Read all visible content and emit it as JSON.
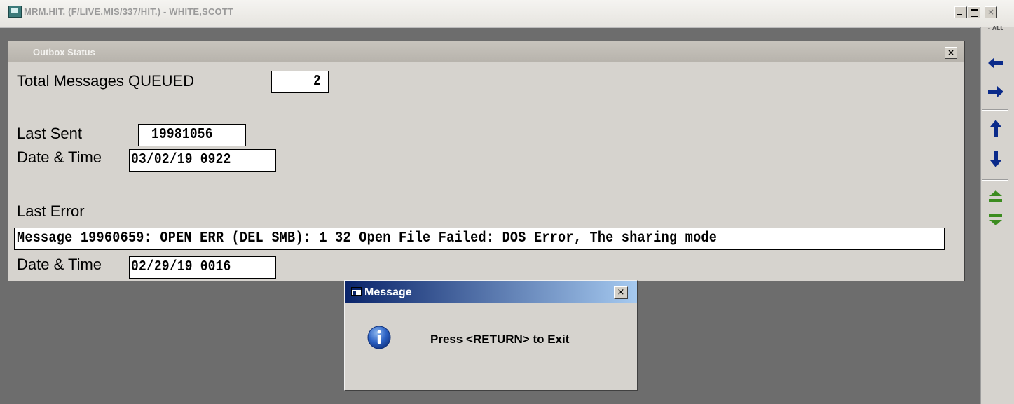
{
  "window": {
    "title": "MRM.HIT. (F/LIVE.MIS/337/HIT.) - WHITE,SCOTT",
    "minimize_label": "",
    "restore_label": "",
    "close_label": "×"
  },
  "right_toolbar": {
    "all_label": "- ALL",
    "buttons": [
      "arrow-left-icon",
      "arrow-right-icon",
      "arrow-up-icon",
      "arrow-down-icon",
      "page-up-icon",
      "page-down-icon"
    ],
    "colors": {
      "arrow": "#0a2a8a",
      "page": "#3c8c20"
    }
  },
  "outbox_status": {
    "title": "Outbox Status",
    "close_label": "×",
    "total_queued_label": "Total Messages QUEUED",
    "total_queued_value": "2",
    "last_sent_label": "Last Sent",
    "last_sent_value": "19981056",
    "sent_datetime_label": "Date & Time",
    "sent_datetime_value": "03/02/19 0922",
    "last_error_label": "Last Error",
    "last_error_value": "Message 19960659: OPEN ERR (DEL SMB):  1 32 Open File Failed: DOS Error, The sharing mode",
    "error_datetime_label": "Date & Time",
    "error_datetime_value": "02/29/19 0016"
  },
  "message_dialog": {
    "title": "Message",
    "close_label": "×",
    "icon": "info-icon",
    "text": "Press <RETURN> to Exit"
  }
}
